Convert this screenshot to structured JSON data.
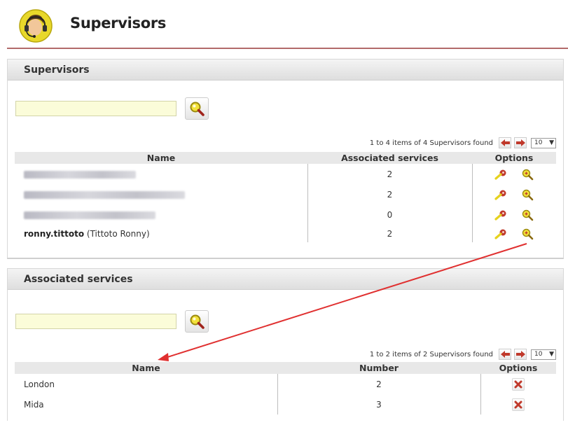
{
  "page": {
    "title": "Supervisors"
  },
  "supervisors_panel": {
    "title": "Supervisors",
    "search": {
      "value": "",
      "placeholder": ""
    },
    "pager": {
      "summary": "1 to 4 items of 4 Supervisors found",
      "page_size": "10"
    },
    "columns": [
      "Name",
      "Associated services",
      "Options"
    ],
    "rows": [
      {
        "name": "",
        "full_name": "",
        "associated_services": "2",
        "blurred": true
      },
      {
        "name": "",
        "full_name": "",
        "associated_services": "2",
        "blurred": true
      },
      {
        "name": "",
        "full_name": "",
        "associated_services": "0",
        "blurred": true
      },
      {
        "name": "ronny.tittoto",
        "full_name": "(Tittoto Ronny)",
        "associated_services": "2",
        "blurred": false
      }
    ]
  },
  "services_panel": {
    "title": "Associated services",
    "search": {
      "value": "",
      "placeholder": ""
    },
    "pager": {
      "summary": "1 to 2 items of 2 Supervisors found",
      "page_size": "10"
    },
    "columns": [
      "Name",
      "Number",
      "Options"
    ],
    "rows": [
      {
        "name": "London",
        "number": "2"
      },
      {
        "name": "Mida",
        "number": "3"
      }
    ]
  },
  "icons": {
    "logo": "headset-agent-icon",
    "search": "magnifier-icon",
    "edit": "key-icon",
    "view": "zoom-icon",
    "delete": "delete-x-icon",
    "prev": "arrow-left-icon",
    "next": "arrow-right-icon"
  },
  "colors": {
    "header_rule": "#b26a6a",
    "search_bg": "#fbfcd9",
    "annotation_arrow": "#e03030",
    "accent_red": "#c0392b",
    "accent_yellow": "#e6d21e"
  }
}
